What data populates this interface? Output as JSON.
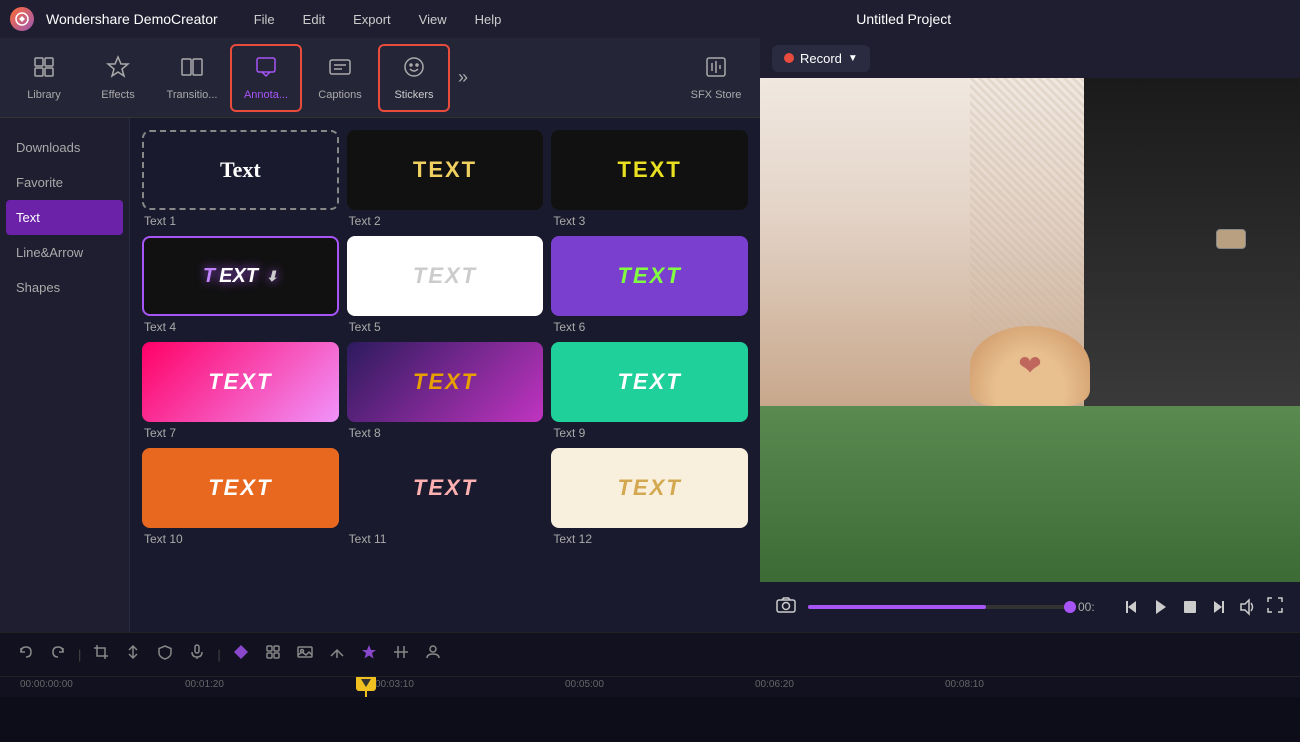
{
  "app": {
    "name": "Wondershare DemoCreator",
    "logo_text": "W",
    "project_title": "Untitled Project"
  },
  "menu": {
    "items": [
      "File",
      "Edit",
      "Export",
      "View",
      "Help"
    ]
  },
  "toolbar": {
    "items": [
      {
        "id": "library",
        "label": "Library",
        "icon": "📚"
      },
      {
        "id": "effects",
        "label": "Effects",
        "icon": "✨"
      },
      {
        "id": "transitions",
        "label": "Transitio...",
        "icon": "⬛"
      },
      {
        "id": "annotations",
        "label": "Annota...",
        "icon": "📝",
        "active": true,
        "highlighted": true
      },
      {
        "id": "captions",
        "label": "Captions",
        "icon": "💬"
      },
      {
        "id": "stickers",
        "label": "Stickers",
        "icon": "🎭",
        "highlighted": true
      },
      {
        "id": "sfx-store",
        "label": "SFX Store",
        "icon": "🎵"
      }
    ],
    "more_icon": "»"
  },
  "sidebar": {
    "items": [
      {
        "id": "downloads",
        "label": "Downloads"
      },
      {
        "id": "favorite",
        "label": "Favorite"
      },
      {
        "id": "text",
        "label": "Text",
        "active": true
      },
      {
        "id": "line-arrow",
        "label": "Line&Arrow"
      },
      {
        "id": "shapes",
        "label": "Shapes"
      }
    ]
  },
  "text_items": [
    {
      "id": "text1",
      "label": "Text 1",
      "thumb_class": "thumb-1",
      "text": "Text"
    },
    {
      "id": "text2",
      "label": "Text 2",
      "thumb_class": "thumb-2",
      "text": "TEXT"
    },
    {
      "id": "text3",
      "label": "Text 3",
      "thumb_class": "thumb-3",
      "text": "TEXT"
    },
    {
      "id": "text4",
      "label": "Text 4",
      "thumb_class": "thumb-4",
      "text": "TEXT",
      "selected": true
    },
    {
      "id": "text5",
      "label": "Text 5",
      "thumb_class": "thumb-5",
      "text": "TEXT"
    },
    {
      "id": "text6",
      "label": "Text 6",
      "thumb_class": "thumb-6",
      "text": "TEXT"
    },
    {
      "id": "text7",
      "label": "Text 7",
      "thumb_class": "thumb-7",
      "text": "TEXT"
    },
    {
      "id": "text8",
      "label": "Text 8",
      "thumb_class": "thumb-8",
      "text": "TEXT"
    },
    {
      "id": "text9",
      "label": "Text 9",
      "thumb_class": "thumb-9",
      "text": "TEXT"
    },
    {
      "id": "text10",
      "label": "Text 10",
      "thumb_class": "thumb-10",
      "text": "TEXT"
    },
    {
      "id": "text11",
      "label": "Text 11",
      "thumb_class": "thumb-11",
      "text": "TEXT"
    },
    {
      "id": "text12",
      "label": "Text 12",
      "thumb_class": "thumb-12",
      "text": "TEXT"
    }
  ],
  "preview": {
    "record_label": "Record",
    "time_display": "00:",
    "progress_percent": 68
  },
  "timeline": {
    "timestamps": [
      "00:00:00:00",
      "00:01:20",
      "00:03:10",
      "00:05:00",
      "00:06:20",
      "00:08:10"
    ],
    "buttons": [
      "undo",
      "redo",
      "crop",
      "split",
      "shield",
      "mic",
      "diamond1",
      "group",
      "image",
      "forward",
      "sticker",
      "trim",
      "user"
    ]
  }
}
